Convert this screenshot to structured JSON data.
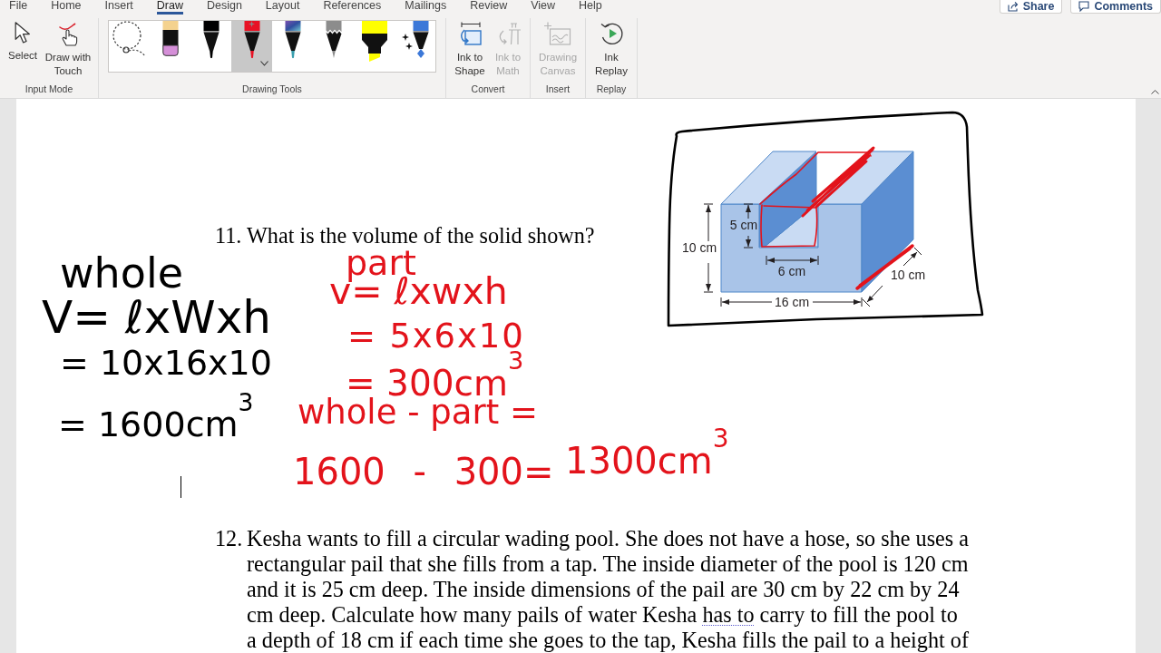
{
  "tabs": [
    {
      "label": "File",
      "selected": false
    },
    {
      "label": "Home",
      "selected": false
    },
    {
      "label": "Insert",
      "selected": false
    },
    {
      "label": "Draw",
      "selected": true
    },
    {
      "label": "Design",
      "selected": false
    },
    {
      "label": "Layout",
      "selected": false
    },
    {
      "label": "References",
      "selected": false
    },
    {
      "label": "Mailings",
      "selected": false
    },
    {
      "label": "Review",
      "selected": false
    },
    {
      "label": "View",
      "selected": false
    },
    {
      "label": "Help",
      "selected": false
    }
  ],
  "header_buttons": [
    {
      "kind": "share",
      "label": "Share"
    },
    {
      "kind": "comments",
      "label": "Comments"
    }
  ],
  "ribbon_groups": [
    {
      "label": "Input Mode",
      "buttons": [
        {
          "kind": "select",
          "label": "Select",
          "disabled": false
        },
        {
          "kind": "touch",
          "label": "Draw with Touch",
          "disabled": false
        }
      ]
    },
    {
      "label": "Drawing Tools",
      "gallery": [
        {
          "kind": "lasso",
          "selected": false
        },
        {
          "kind": "eraser",
          "selected": false
        },
        {
          "kind": "pen",
          "color": "#000000",
          "selected": false
        },
        {
          "kind": "pen",
          "color": "#e81224",
          "selected": true
        },
        {
          "kind": "galaxy_pen",
          "color": "#3a9fae",
          "selected": false
        },
        {
          "kind": "pencil",
          "color": "#8c8c8c",
          "selected": false
        },
        {
          "kind": "highlighter",
          "color": "#ffff00",
          "selected": false
        },
        {
          "kind": "action_pen",
          "color": "#3c78d8",
          "selected": false
        }
      ]
    },
    {
      "label": "Convert",
      "buttons": [
        {
          "kind": "ink_to_shape",
          "label": "Ink to Shape",
          "disabled": false
        },
        {
          "kind": "ink_to_math",
          "label": "Ink to Math",
          "disabled": true
        }
      ]
    },
    {
      "label": "Insert",
      "buttons": [
        {
          "kind": "canvas",
          "label": "Drawing Canvas",
          "disabled": true
        }
      ]
    },
    {
      "label": "Replay",
      "buttons": [
        {
          "kind": "replay",
          "label": "Ink Replay",
          "disabled": false
        }
      ]
    }
  ],
  "document": {
    "questions": [
      {
        "number": "11.",
        "parts": [
          {
            "text": "What is the volume of the solid shown?",
            "flagged": false
          }
        ]
      },
      {
        "number": "12.",
        "parts": [
          {
            "text": "Kesha wants to fill a circular wading pool. She does not have a hose, so she uses a\nrectangular pail that she fills from a tap. The inside diameter of the pool is 120 cm\nand it is 25 cm deep. The inside dimensions of the pail are 30 cm by 22 cm by 24\ncm deep. Calculate how many pails of water Kesha ",
            "flagged": false
          },
          {
            "text": "has to",
            "flagged": true
          },
          {
            "text": " carry to fill the pool to\na depth of 18 cm if each time she goes to the tap, Kesha fills the pail to a height of",
            "flagged": false
          }
        ]
      }
    ],
    "figure": {
      "dimension_labels": [
        "10 cm",
        "5 cm",
        "6 cm",
        "16 cm",
        "10 cm"
      ]
    },
    "ink": [
      {
        "text": "whole",
        "color": "#000000"
      },
      {
        "text": "V= ℓxWxh",
        "color": "#000000"
      },
      {
        "text": "= 10x16x10",
        "color": "#000000"
      },
      {
        "text": "= 1600cm$^{3}$",
        "color": "#000000"
      },
      {
        "text": "part",
        "color": "#e3131b"
      },
      {
        "text": "v= ℓxwxh",
        "color": "#e3131b"
      },
      {
        "text": "= 5x6x10",
        "color": "#e3131b"
      },
      {
        "text": "= 300cm$^{3}$",
        "color": "#e3131b"
      },
      {
        "text": "whole - part =",
        "color": "#e3131b"
      },
      {
        "text": "1600 - 300=",
        "color": "#e3131b"
      },
      {
        "text": "1300cm$^{3}$",
        "color": "#e3131b"
      }
    ]
  }
}
